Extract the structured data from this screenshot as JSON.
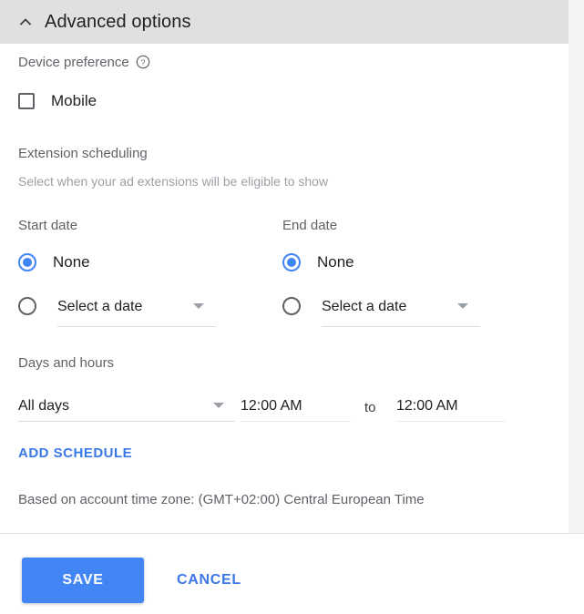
{
  "colors": {
    "accent": "#4285f4",
    "link": "#3b78e7",
    "header_bg": "#e0e0e0",
    "label_text": "#5f6368",
    "muted_text": "#9aa0a6",
    "body_text": "#202124",
    "divider": "#e0e0e0",
    "scrollbar_track": "#f1f3f4"
  },
  "advanced_section": {
    "title": "Advanced options",
    "collapse_icon": "chevron-up-icon",
    "expanded": true
  },
  "device_preference": {
    "label": "Device preference",
    "help_icon": "help-circle-icon",
    "checkbox": {
      "label": "Mobile",
      "checked": false
    }
  },
  "extension_scheduling": {
    "title": "Extension scheduling",
    "subtitle": "Select when your ad extensions will be eligible to show",
    "start_date": {
      "label": "Start date",
      "options": [
        {
          "label": "None",
          "selected": true
        },
        {
          "label": "Select a date",
          "selected": false
        }
      ],
      "select_caret_icon": "chevron-down-icon"
    },
    "end_date": {
      "label": "End date",
      "options": [
        {
          "label": "None",
          "selected": true
        },
        {
          "label": "Select a date",
          "selected": false
        }
      ],
      "select_caret_icon": "chevron-down-icon"
    },
    "days_and_hours": {
      "label": "Days and hours",
      "days_select": {
        "value": "All days",
        "caret_icon": "chevron-down-icon"
      },
      "start_time": "12:00 AM",
      "separator": "to",
      "end_time": "12:00 AM"
    },
    "add_schedule_label": "ADD SCHEDULE",
    "timezone_note": "Based on account time zone: (GMT+02:00) Central European Time"
  },
  "footer": {
    "save_label": "SAVE",
    "cancel_label": "CANCEL"
  }
}
